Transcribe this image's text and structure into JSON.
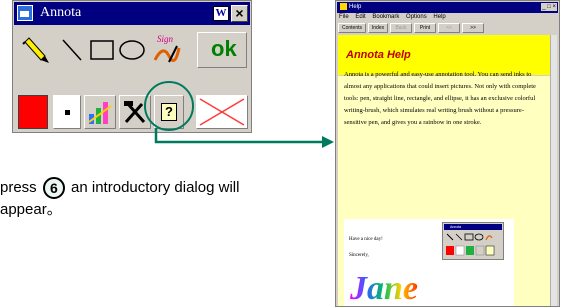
{
  "annota_window": {
    "title": "Annota",
    "word_icon_glyph": "W",
    "close_glyph": "×",
    "ok_label": "ok",
    "sign_label": "Sign",
    "colors": {
      "title_bar": "#000080",
      "ok_text": "#008000",
      "red_swatch": "#ff0000",
      "highlight_ring": "#007a5e",
      "eraser_x": "#ff3a3a"
    },
    "tools": [
      {
        "name": "highlighter-icon"
      },
      {
        "name": "straight-line-icon"
      },
      {
        "name": "rectangle-icon"
      },
      {
        "name": "ellipse-icon"
      },
      {
        "name": "signature-brush-icon"
      },
      {
        "name": "ok-button"
      },
      {
        "name": "color-swatch-red"
      },
      {
        "name": "pen-size-icon"
      },
      {
        "name": "gallery-icon"
      },
      {
        "name": "tools-settings-icon"
      },
      {
        "name": "help-question-icon"
      },
      {
        "name": "clear-x-icon"
      }
    ]
  },
  "caption": {
    "before": "press",
    "step_number": "6",
    "after": "an introductory dialog will",
    "line2": "appear。"
  },
  "help_window": {
    "title": "Help",
    "window_controls": "_ □ ×",
    "menu": [
      "File",
      "Edit",
      "Bookmark",
      "Options",
      "Help"
    ],
    "buttons": [
      {
        "label": "Contents",
        "disabled": false
      },
      {
        "label": "Index",
        "disabled": false
      },
      {
        "label": "Back",
        "disabled": true
      },
      {
        "label": "Print",
        "disabled": false
      },
      {
        "label": "<<",
        "disabled": true
      },
      {
        "label": ">>",
        "disabled": false
      }
    ],
    "heading": "Annota Help",
    "paragraph": "Annota is a powerful and easy-use annotation tool. You can send inks to almost any applications that could insert pictures. Not only with complete tools: pen, straight line, rectangle, and ellipse, it has an exclusive colorful writing-brush, which simulates real writing brush without a pressure-sensitive pen, and gives you a rainbow in one stroke.",
    "inset": {
      "line1": "Have a nice day!",
      "line2": "Sincerely,",
      "signature": "Jane",
      "mini_title": "Annota"
    },
    "colors": {
      "header_bg": "#ffff00",
      "heading_text": "#c00000",
      "body_bg": "#ffffc0"
    }
  }
}
